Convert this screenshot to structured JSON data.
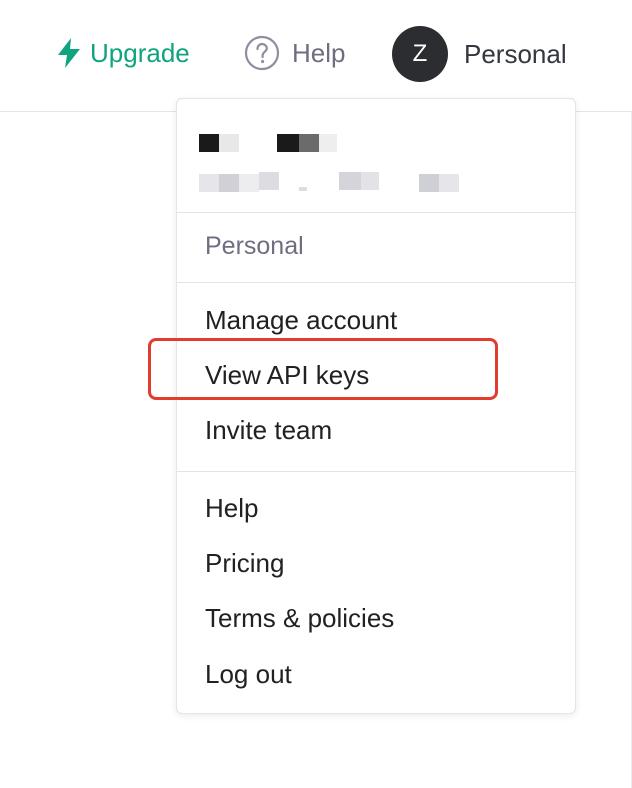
{
  "topbar": {
    "upgrade_label": "Upgrade",
    "help_label": "Help",
    "avatar_initial": "Z",
    "account_label": "Personal"
  },
  "menu": {
    "org_label": "Personal",
    "account_items": [
      "Manage account",
      "View API keys",
      "Invite team"
    ],
    "general_items": [
      "Help",
      "Pricing",
      "Terms & policies",
      "Log out"
    ]
  },
  "colors": {
    "accent": "#10a37f",
    "highlight": "#e23c2f",
    "avatar_bg": "#2c2d31"
  },
  "icons": {
    "upgrade": "lightning-bolt-icon",
    "help": "question-circle-icon"
  }
}
